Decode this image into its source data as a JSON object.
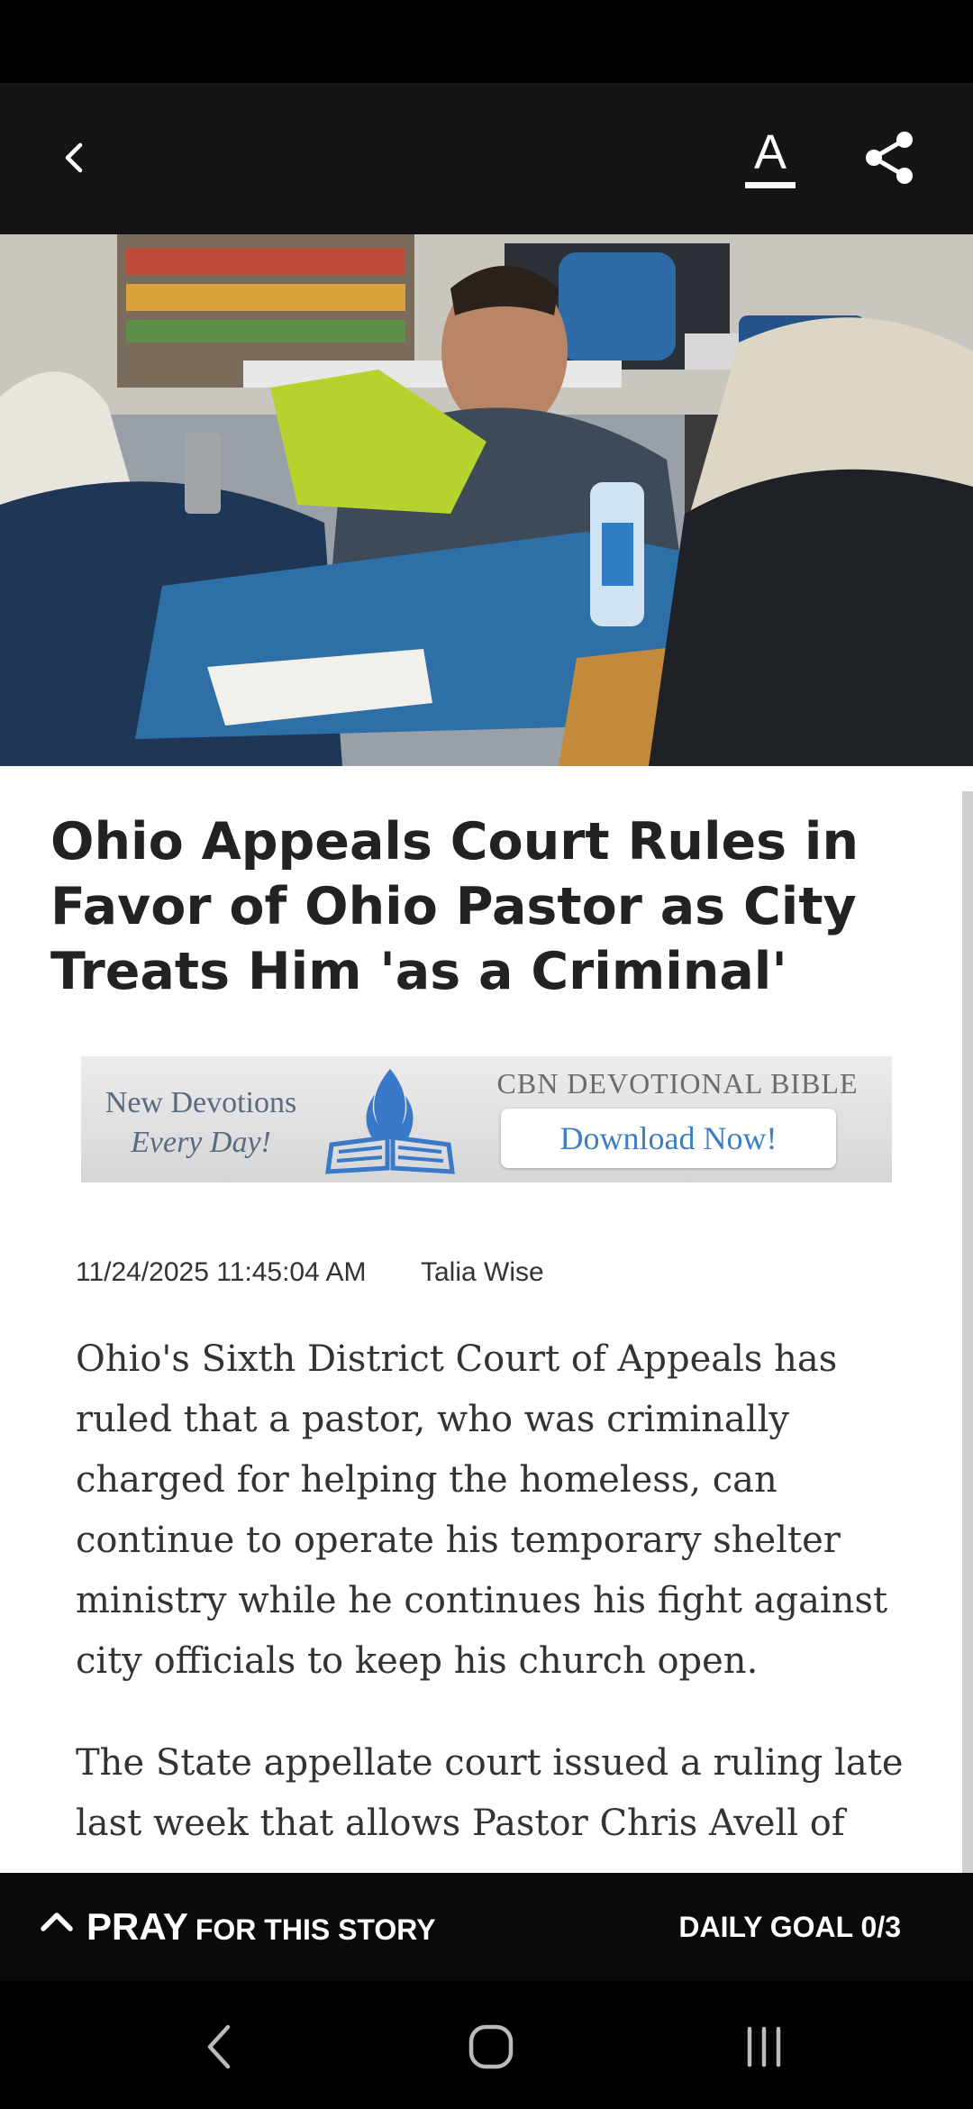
{
  "header": {
    "font_button_glyph": "A"
  },
  "article": {
    "headline": "Ohio Appeals Court Rules in Favor of Ohio Pastor as City Treats Him 'as a Criminal'",
    "date": "11/24/2025 11:45:04 AM",
    "author": "Talia Wise",
    "paragraphs": [
      "Ohio's Sixth District Court of Appeals has ruled that a pastor, who was criminally charged for helping the homeless, can continue to operate his temporary shelter ministry while he continues his fight against city officials to keep his church open.",
      "The State appellate court issued a ruling late last week that allows Pastor Chris Avell of"
    ]
  },
  "ad": {
    "left_text_line1": "New Devotions",
    "left_text_line2": "Every Day!",
    "title": "CBN DEVOTIONAL BIBLE",
    "cta": "Download Now!"
  },
  "pray_bar": {
    "pray_label": "PRAY",
    "pray_suffix": "FOR THIS STORY",
    "goal_text": "DAILY GOAL 0/3"
  },
  "colors": {
    "header_bg": "#151515",
    "ad_cta_text": "#3d7fc6",
    "pray_bar_bg": "#0a0a0a"
  }
}
